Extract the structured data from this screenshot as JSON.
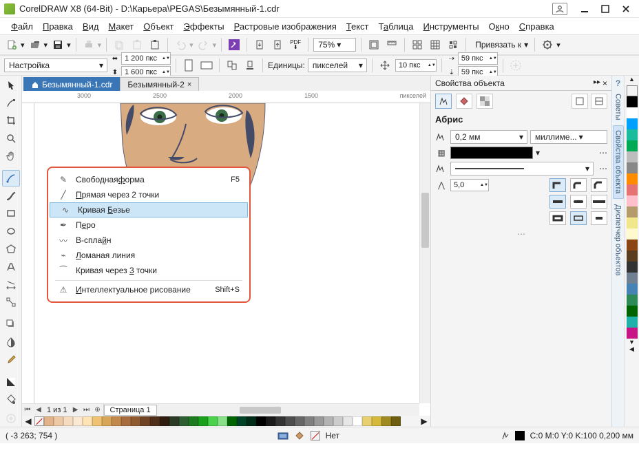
{
  "title": "CorelDRAW X8 (64-Bit) - D:\\Карьера\\PEGAS\\Безымянный-1.cdr",
  "menu": [
    "Файл",
    "Правка",
    "Вид",
    "Макет",
    "Объект",
    "Эффекты",
    "Растровые изображения",
    "Текст",
    "Таблица",
    "Инструменты",
    "Окно",
    "Справка"
  ],
  "zoom": "75%",
  "snap_label": "Привязать к",
  "propbar": {
    "selector": "Настройка",
    "width": "1 200 пкс",
    "height": "1 600 пкс",
    "units_label": "Единицы:",
    "units_value": "пикселей",
    "nudge": "10 пкс",
    "dup_x": "59 пкс",
    "dup_y": "59 пкс"
  },
  "tabs": {
    "active": "Безымянный-1.cdr",
    "inactive": "Безымянный-2"
  },
  "ruler": {
    "ticks": [
      "3000",
      "2500",
      "2000",
      "1500"
    ],
    "label": "пикселей"
  },
  "pager": {
    "text": "1  из  1",
    "page_label": "Страница 1"
  },
  "flyout": {
    "items": [
      {
        "label_pre": "Свободная",
        "u": "ф",
        "label_post": "орма",
        "shortcut": "F5"
      },
      {
        "label_pre": "",
        "u": "П",
        "label_post": "рямая через 2 точки",
        "shortcut": ""
      },
      {
        "label_pre": "Кривая ",
        "u": "Б",
        "label_post": "езье",
        "shortcut": "",
        "hi": true
      },
      {
        "label_pre": "П",
        "u": "е",
        "label_post": "ро",
        "shortcut": ""
      },
      {
        "label_pre": "B-спла",
        "u": "й",
        "label_post": "н",
        "shortcut": ""
      },
      {
        "label_pre": "",
        "u": "Л",
        "label_post": "оманая линия",
        "shortcut": ""
      },
      {
        "label_pre": "Кривая через ",
        "u": "3",
        "label_post": " точки",
        "shortcut": ""
      }
    ],
    "last": {
      "label_pre": "",
      "u": "И",
      "label_post": "нтеллектуальное рисование",
      "shortcut": "Shift+S"
    }
  },
  "docker": {
    "title": "Свойства объекта",
    "section": "Абрис",
    "width_value": "0,2 мм",
    "units_value": "миллиме...",
    "miter": "5,0"
  },
  "sidetabs": [
    "Советы",
    "Свойства объекта",
    "Диспетчер объектов"
  ],
  "status": {
    "cursor": "( -3 263; 754   )",
    "none": "Нет",
    "outline": "C:0 M:0 Y:0 K:100  0,200 мм"
  },
  "palette_colors": [
    "#000",
    "#fff",
    "#00a0ff",
    "#1abc9c",
    "#0a5",
    "#bdbdbd",
    "#888",
    "#ff8c00",
    "#e57373",
    "#ffc0cb",
    "#b59a6b",
    "#f0e68c",
    "#fffacd",
    "#8b4513",
    "#5a3d1e",
    "#333",
    "#708090",
    "#4682b4",
    "#2e8b57",
    "#006400",
    "#20b2aa",
    "#c71585"
  ],
  "colorstrip": [
    "#e2b28a",
    "#edc9a6",
    "#f5dcc0",
    "#fce9d4",
    "#ffe4b5",
    "#eec373",
    "#d8a657",
    "#c2894d",
    "#a86c3e",
    "#8e5a30",
    "#6f4323",
    "#4f2f19",
    "#301c0f",
    "#2b3a24",
    "#2e5d34",
    "#1e7a1e",
    "#1aa01a",
    "#4bd14b",
    "#88e188",
    "#006400",
    "#004225",
    "#002b17",
    "#000",
    "#1a1a1a",
    "#333",
    "#4d4d4d",
    "#666",
    "#808080",
    "#999",
    "#b3b3b3",
    "#ccc",
    "#e6e6e6",
    "#fff",
    "#e8d070",
    "#d4b93a",
    "#a08b20",
    "#6e5e0f"
  ]
}
